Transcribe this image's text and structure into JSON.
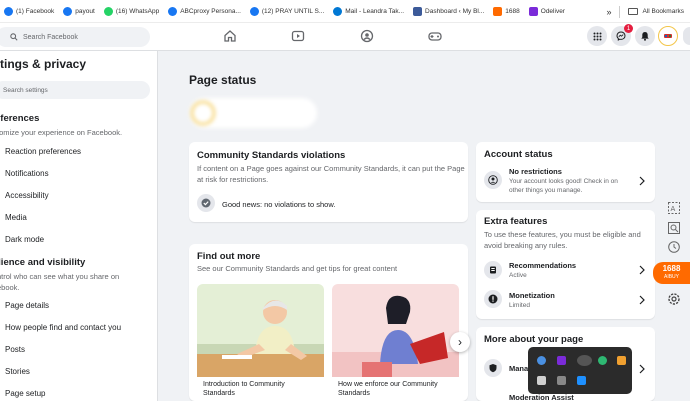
{
  "bookmarks": {
    "items": [
      {
        "label": "(1) Facebook",
        "color": "#1877f2"
      },
      {
        "label": "payout",
        "color": "#1877f2"
      },
      {
        "label": "(16) WhatsApp",
        "color": "#25d366"
      },
      {
        "label": "ABCproxy Persona...",
        "color": "#1877f2"
      },
      {
        "label": "(12) PRAY UNTIL S...",
        "color": "#1877f2"
      },
      {
        "label": "Mail - Leandra Tak...",
        "color": "#0078d4"
      },
      {
        "label": "Dashboard ‹ My Bl...",
        "color": "#3c5a99"
      },
      {
        "label": "1688",
        "color": "#ff6a00"
      },
      {
        "label": "Odeliver",
        "color": "#7b2bd9"
      }
    ],
    "overflow": "»",
    "all_bookmarks": "All Bookmarks"
  },
  "topnav": {
    "search_placeholder": "Search Facebook",
    "notification_count": "1"
  },
  "sidebar": {
    "title": "ttings & privacy",
    "search_placeholder": "Search settings",
    "section1_title": "eferences",
    "section1_desc": "tomize your experience on Facebook.",
    "section1_items": [
      "Reaction preferences",
      "Notifications",
      "Accessibility",
      "Media",
      "Dark mode"
    ],
    "section2_title": "dience and visibility",
    "section2_desc1": "ntrol who can see what you share on",
    "section2_desc2": "ebook.",
    "section2_items": [
      "Page details",
      "How people find and contact you",
      "Posts",
      "Stories",
      "Page setup"
    ]
  },
  "main": {
    "title": "Page status",
    "violations": {
      "title": "Community Standards violations",
      "desc": "If content on a Page goes against our Community Standards, it can put the Page at risk for restrictions.",
      "status": "Good news: no violations to show."
    },
    "find_out": {
      "title": "Find out more",
      "desc": "See our Community Standards and get tips for great content",
      "cards": [
        "Introduction to Community Standards",
        "How we enforce our Community Standards"
      ],
      "next": "›"
    }
  },
  "right": {
    "account": {
      "title": "Account status",
      "row_title": "No restrictions",
      "row_desc": "Your account looks good! Check in on other things you manage."
    },
    "extra": {
      "title": "Extra features",
      "desc": "To use these features, you must be eligible and avoid breaking any rules.",
      "rows": [
        {
          "title": "Recommendations",
          "status": "Active"
        },
        {
          "title": "Monetization",
          "status": "Limited"
        }
      ]
    },
    "more": {
      "title": "More about your page",
      "rows": [
        "Mana",
        "Moderation Assist"
      ]
    }
  },
  "tools": {
    "label_1688": "1688",
    "sub_1688": "AIBUY"
  },
  "colors": {
    "brand_blue": "#1877f2",
    "page_bg": "#f0f2f5",
    "card_bg": "#ffffff",
    "secondary_text": "#65676b",
    "notification_red": "#e41e3f",
    "accent_orange": "#ff6a00"
  }
}
